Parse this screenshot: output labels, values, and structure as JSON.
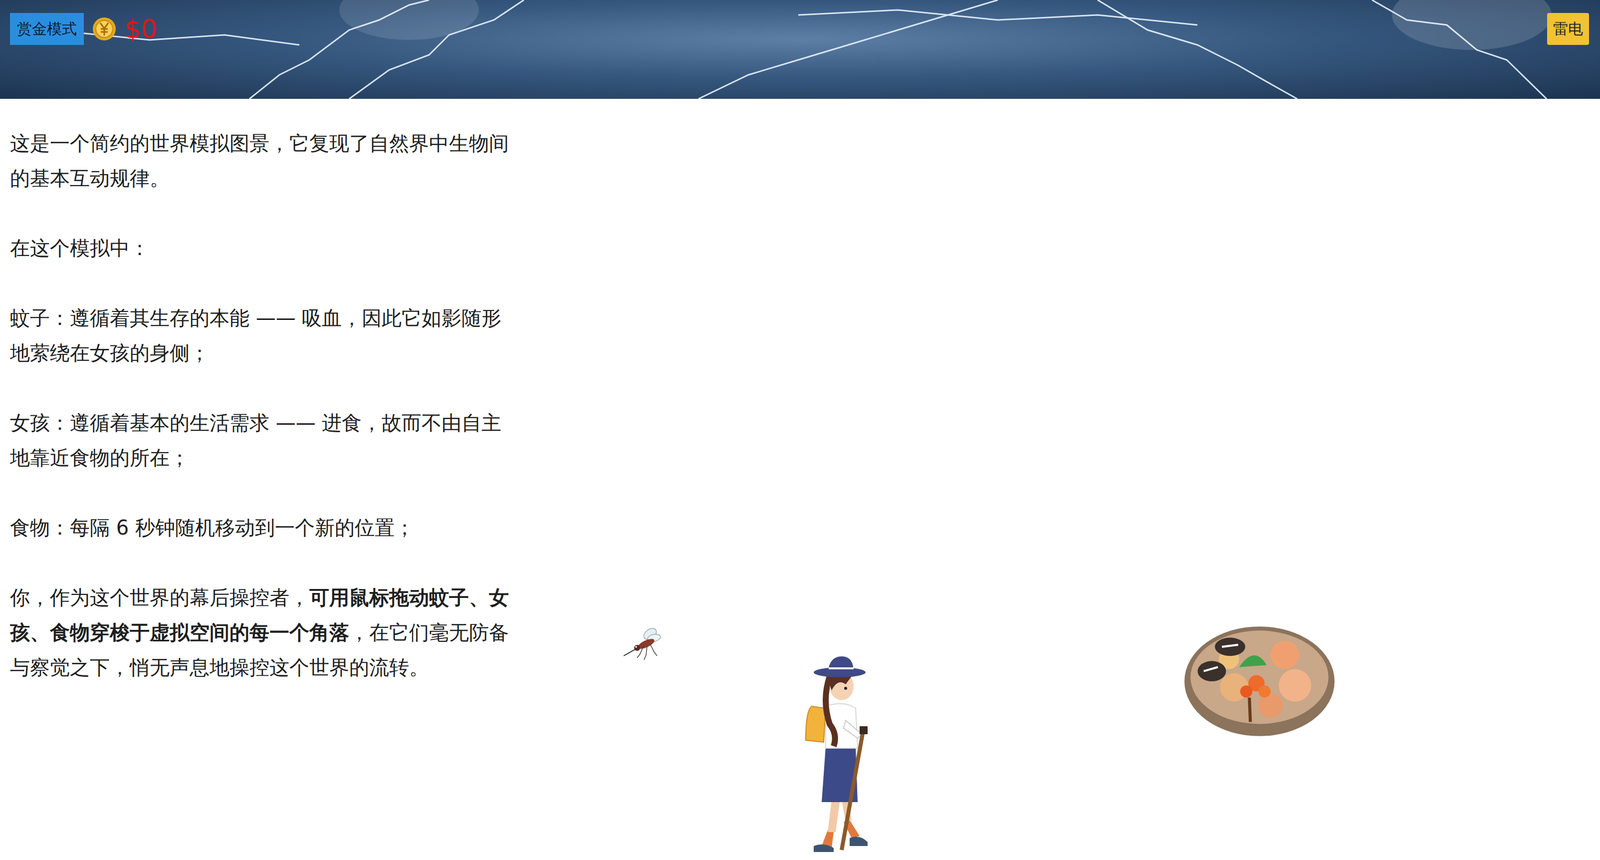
{
  "header": {
    "mode_badge": "赏金模式",
    "money": "$0",
    "weather_button": "雷电"
  },
  "description": {
    "paragraphs": [
      [
        {
          "text": "这是一个简约的世界模拟图景，它复现了自然界中生物间的基本互动规律。",
          "bold": false
        }
      ],
      [
        {
          "text": "在这个模拟中：",
          "bold": false
        }
      ],
      [
        {
          "text": "蚊子：遵循着其生存的本能 —— 吸血，因此它如影随形地萦绕在女孩的身侧；",
          "bold": false
        }
      ],
      [
        {
          "text": "女孩：遵循着基本的生活需求 —— 进食，故而不由自主地靠近食物的所在；",
          "bold": false
        }
      ],
      [
        {
          "text": "食物：每隔 6 秒钟随机移动到一个新的位置；",
          "bold": false
        }
      ],
      [
        {
          "text": "你，作为这个世界的幕后操控者，",
          "bold": false
        },
        {
          "text": "可用鼠标拖动蚊子、女孩、食物穿梭于虚拟空间的每一个角落",
          "bold": true
        },
        {
          "text": "，在它们毫无防备与察觉之下，悄无声息地操控这个世界的流转。",
          "bold": false
        }
      ]
    ]
  }
}
